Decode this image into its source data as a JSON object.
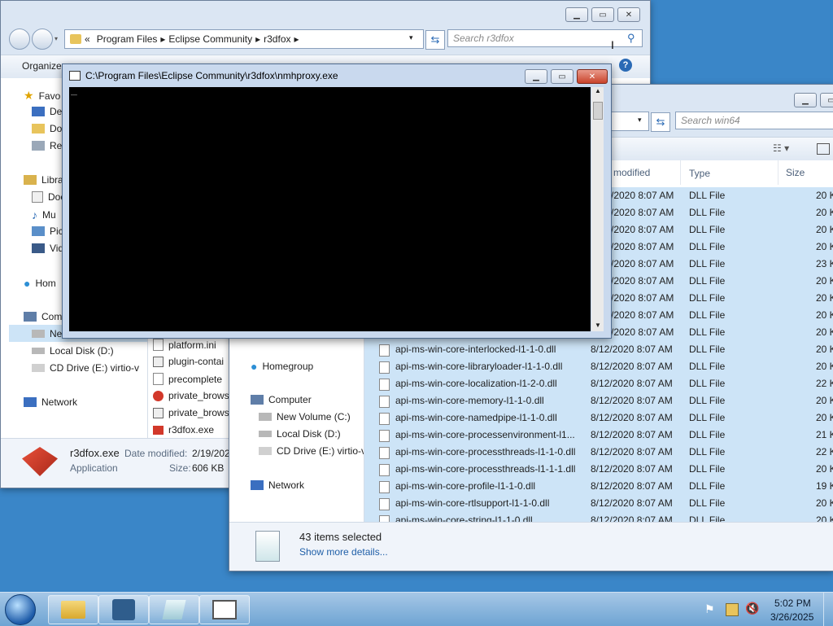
{
  "explorer1": {
    "breadcrumb": [
      "«",
      "Program Files",
      "Eclipse Community",
      "r3dfox"
    ],
    "search_placeholder": "Search r3dfox",
    "toolbar_organize": "Organize",
    "nav": [
      "Favo",
      "Des",
      "Dov",
      "Rec",
      "Libra",
      "Doc",
      "Mu",
      "Pic",
      "Vid",
      "Hom",
      "Com",
      "Ne",
      "Local Disk (D:)",
      "CD Drive (E:) virtio-v",
      "Network"
    ],
    "files": [
      "platform.ini",
      "plugin-contai",
      "precomplete",
      "private_brows",
      "private_brows",
      "r3dfox.exe"
    ],
    "details": {
      "name": "r3dfox.exe",
      "date_label": "Date modified:",
      "date_value": "2/19/202",
      "type": "Application",
      "size_label": "Size:",
      "size_value": "606 KB"
    }
  },
  "console": {
    "title": "C:\\Program Files\\Eclipse Community\\r3dfox\\nmhproxy.exe",
    "cursor": "_"
  },
  "explorer2": {
    "search_placeholder": "Search win64",
    "columns": {
      "modified": "modified",
      "type": "Type",
      "size": "Size"
    },
    "nav": [
      "Homegroup",
      "Computer",
      "New Volume (C:)",
      "Local Disk (D:)",
      "CD Drive (E:) virtio-v",
      "Network"
    ],
    "hidden_rows": [
      {
        "date": "/2020 8:07 AM",
        "type": "DLL File",
        "size": "20 K"
      },
      {
        "date": "/2020 8:07 AM",
        "type": "DLL File",
        "size": "20 K"
      },
      {
        "date": "/2020 8:07 AM",
        "type": "DLL File",
        "size": "20 K"
      },
      {
        "date": "/2020 8:07 AM",
        "type": "DLL File",
        "size": "20 K"
      },
      {
        "date": "/2020 8:07 AM",
        "type": "DLL File",
        "size": "23 K"
      },
      {
        "date": "/2020 8:07 AM",
        "type": "DLL File",
        "size": "20 K"
      },
      {
        "date": "/2020 8:07 AM",
        "type": "DLL File",
        "size": "20 K"
      },
      {
        "date": "/2020 8:07 AM",
        "type": "DLL File",
        "size": "20 K"
      },
      {
        "date": "/2020 8:07 AM",
        "type": "DLL File",
        "size": "20 K"
      }
    ],
    "rows": [
      {
        "name": "api-ms-win-core-interlocked-l1-1-0.dll",
        "date": "8/12/2020 8:07 AM",
        "type": "DLL File",
        "size": "20 K"
      },
      {
        "name": "api-ms-win-core-libraryloader-l1-1-0.dll",
        "date": "8/12/2020 8:07 AM",
        "type": "DLL File",
        "size": "20 K"
      },
      {
        "name": "api-ms-win-core-localization-l1-2-0.dll",
        "date": "8/12/2020 8:07 AM",
        "type": "DLL File",
        "size": "22 K"
      },
      {
        "name": "api-ms-win-core-memory-l1-1-0.dll",
        "date": "8/12/2020 8:07 AM",
        "type": "DLL File",
        "size": "20 K"
      },
      {
        "name": "api-ms-win-core-namedpipe-l1-1-0.dll",
        "date": "8/12/2020 8:07 AM",
        "type": "DLL File",
        "size": "20 K"
      },
      {
        "name": "api-ms-win-core-processenvironment-l1...",
        "date": "8/12/2020 8:07 AM",
        "type": "DLL File",
        "size": "21 K"
      },
      {
        "name": "api-ms-win-core-processthreads-l1-1-0.dll",
        "date": "8/12/2020 8:07 AM",
        "type": "DLL File",
        "size": "22 K"
      },
      {
        "name": "api-ms-win-core-processthreads-l1-1-1.dll",
        "date": "8/12/2020 8:07 AM",
        "type": "DLL File",
        "size": "20 K"
      },
      {
        "name": "api-ms-win-core-profile-l1-1-0.dll",
        "date": "8/12/2020 8:07 AM",
        "type": "DLL File",
        "size": "19 K"
      },
      {
        "name": "api-ms-win-core-rtlsupport-l1-1-0.dll",
        "date": "8/12/2020 8:07 AM",
        "type": "DLL File",
        "size": "20 K"
      },
      {
        "name": "api-ms-win-core-string-l1-1-0.dll",
        "date": "8/12/2020 8:07 AM",
        "type": "DLL File",
        "size": "20 K"
      }
    ],
    "status": {
      "count": "43 items selected",
      "more": "Show more details..."
    }
  },
  "taskbar": {
    "time": "5:02 PM",
    "date": "3/26/2025",
    "buttons": [
      "start-orb-icon",
      "explorer-icon",
      "network-app-icon",
      "notebook-icon",
      "window-icon"
    ]
  },
  "colors": {
    "desktop": "#3a86c8",
    "console_bg": "#000000",
    "close_red": "#c9432b"
  }
}
